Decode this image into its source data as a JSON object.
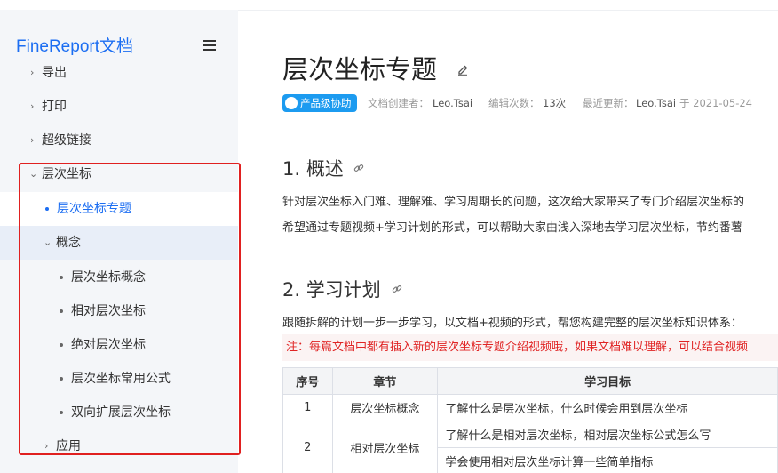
{
  "sidebar": {
    "brand": "FineReport文档",
    "items": [
      {
        "label": "导出"
      },
      {
        "label": "打印"
      },
      {
        "label": "超级链接"
      },
      {
        "label": "层次坐标"
      },
      {
        "label": "层次坐标专题"
      },
      {
        "label": "概念"
      },
      {
        "label": "层次坐标概念"
      },
      {
        "label": "相对层次坐标"
      },
      {
        "label": "绝对层次坐标"
      },
      {
        "label": "层次坐标常用公式"
      },
      {
        "label": "双向扩展层次坐标"
      },
      {
        "label": "应用"
      }
    ]
  },
  "page": {
    "title": "层次坐标专题",
    "badge": "产品级协助",
    "creator_label": "文档创建者：",
    "creator": "Leo.Tsai",
    "edits_label": "编辑次数：",
    "edits": "13次",
    "updated_label": "最近更新：",
    "updated_by": "Leo.Tsai",
    "updated_on": "于 2021-05-24"
  },
  "sections": [
    {
      "heading": "1. 概述",
      "lines": [
        "针对层次坐标入门难、理解难、学习周期长的问题，这次给大家带来了专门介绍层次坐标的",
        "希望通过专题视频+学习计划的形式，可以帮助大家由浅入深地去学习层次坐标，节约番薯"
      ]
    },
    {
      "heading": "2. 学习计划",
      "lines": [
        "跟随拆解的计划一步一步学习，以文档+视频的形式，帮您构建完整的层次坐标知识体系："
      ],
      "note": "注：每篇文档中都有插入新的层次坐标专题介绍视频哦，如果文档难以理解，可以结合视频"
    }
  ],
  "table": {
    "headers": [
      "序号",
      "章节",
      "学习目标"
    ],
    "rows": [
      {
        "no": "1",
        "chapter": "层次坐标概念",
        "goal": "了解什么是层次坐标，什么时候会用到层次坐标"
      },
      {
        "no": "2",
        "chapter": "相对层次坐标",
        "goal": "了解什么是相对层次坐标，相对层次坐标公式怎么写",
        "goal2": "学会使用相对层次坐标计算一些简单指标"
      }
    ]
  },
  "colors": {
    "accent": "#1c6ef2",
    "highlight_box": "#e02020",
    "note_text": "#e02424",
    "badge": "#1c9bf0"
  }
}
